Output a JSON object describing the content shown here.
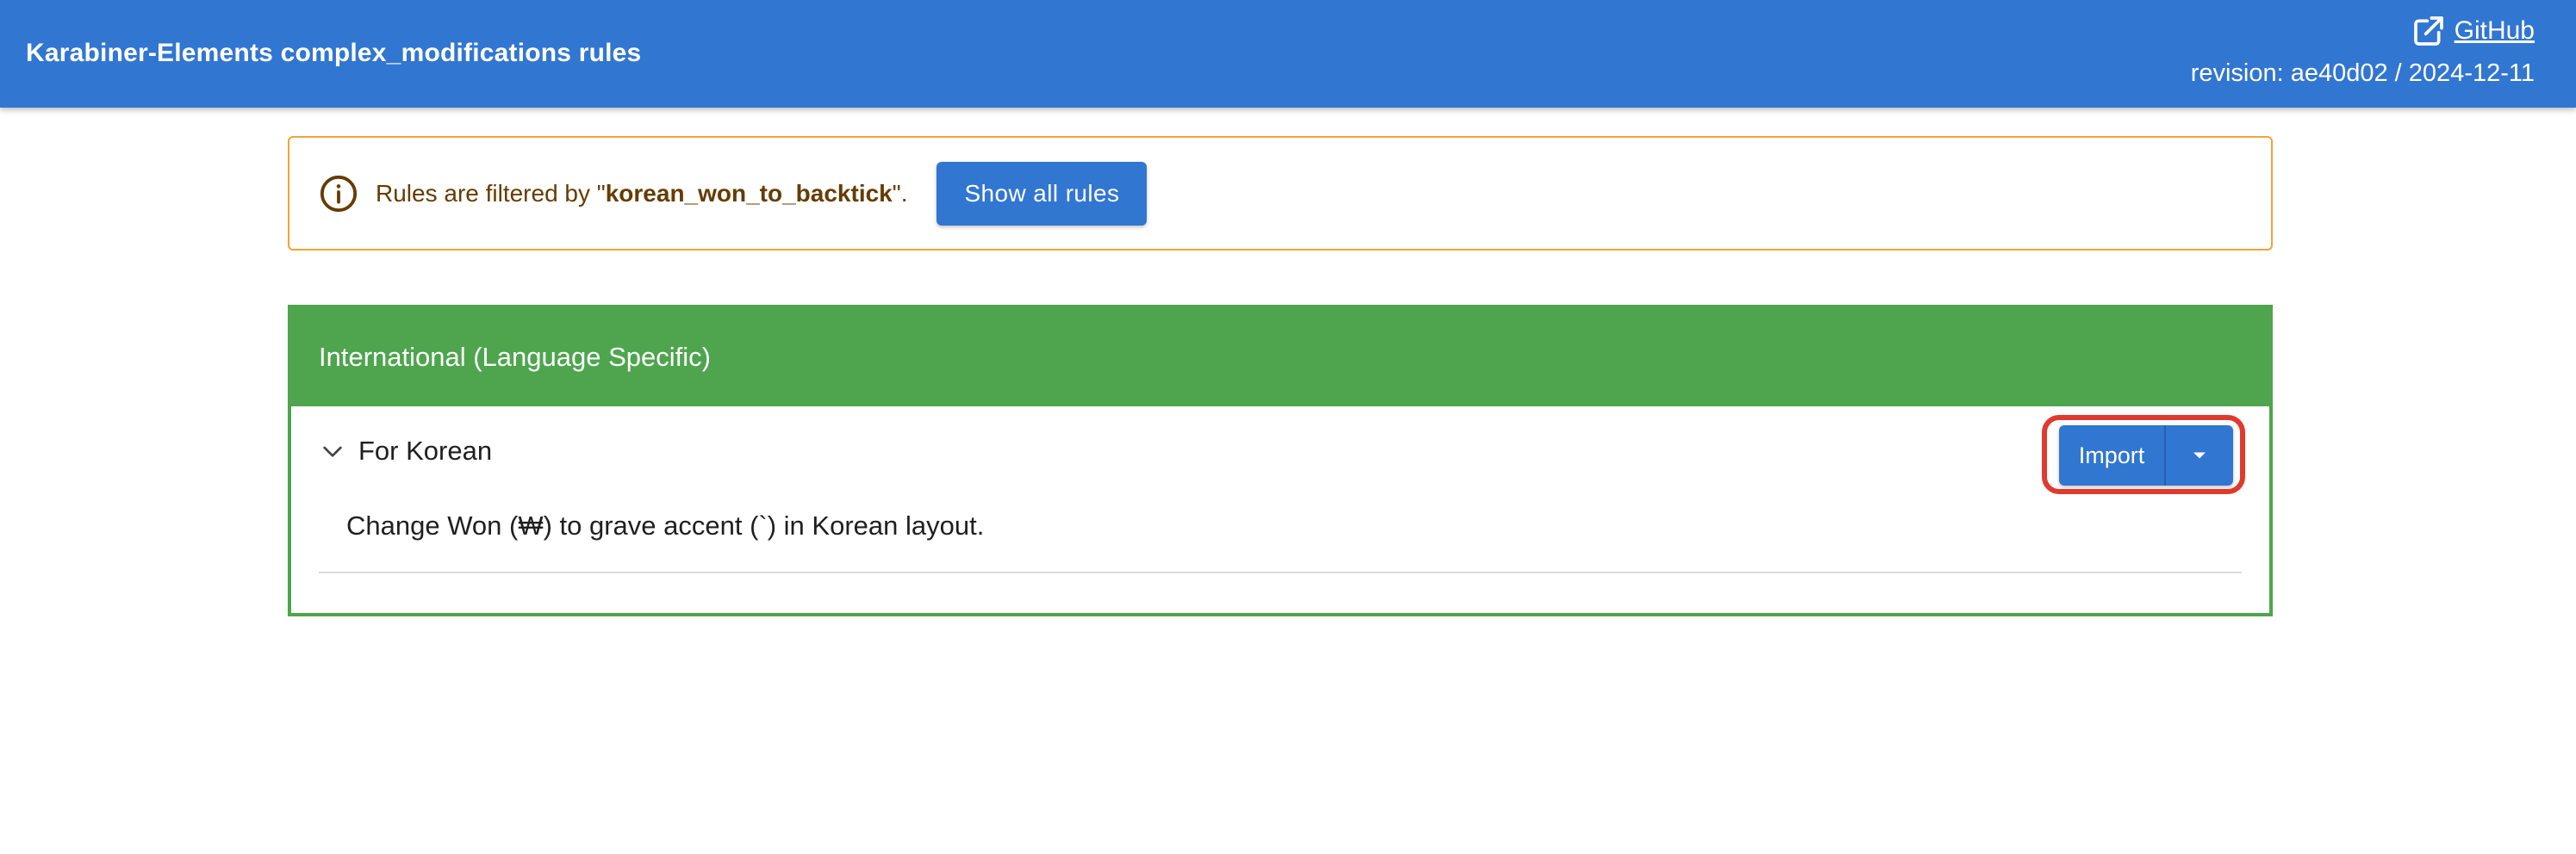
{
  "header": {
    "title": "Karabiner-Elements complex_modifications rules",
    "github_label": "GitHub",
    "revision": "revision: ae40d02 / 2024-12-11",
    "icons": {
      "external_link": "open-in-new-icon"
    }
  },
  "filter_alert": {
    "prefix": "Rules are filtered by \"",
    "filter": "korean_won_to_backtick",
    "suffix": "\".",
    "show_all_label": "Show all rules",
    "icon": "info-icon",
    "colors": {
      "border": "#f0a43a",
      "text": "#663c00"
    }
  },
  "category": {
    "title": "International (Language Specific)",
    "color": "#4ea54e",
    "rules": [
      {
        "title": "For Korean",
        "import_label": "Import",
        "description": "Change Won (₩) to grave accent (`) in Korean layout."
      }
    ]
  },
  "colors": {
    "primary": "#3176d1",
    "highlight": "#e03a2f"
  }
}
